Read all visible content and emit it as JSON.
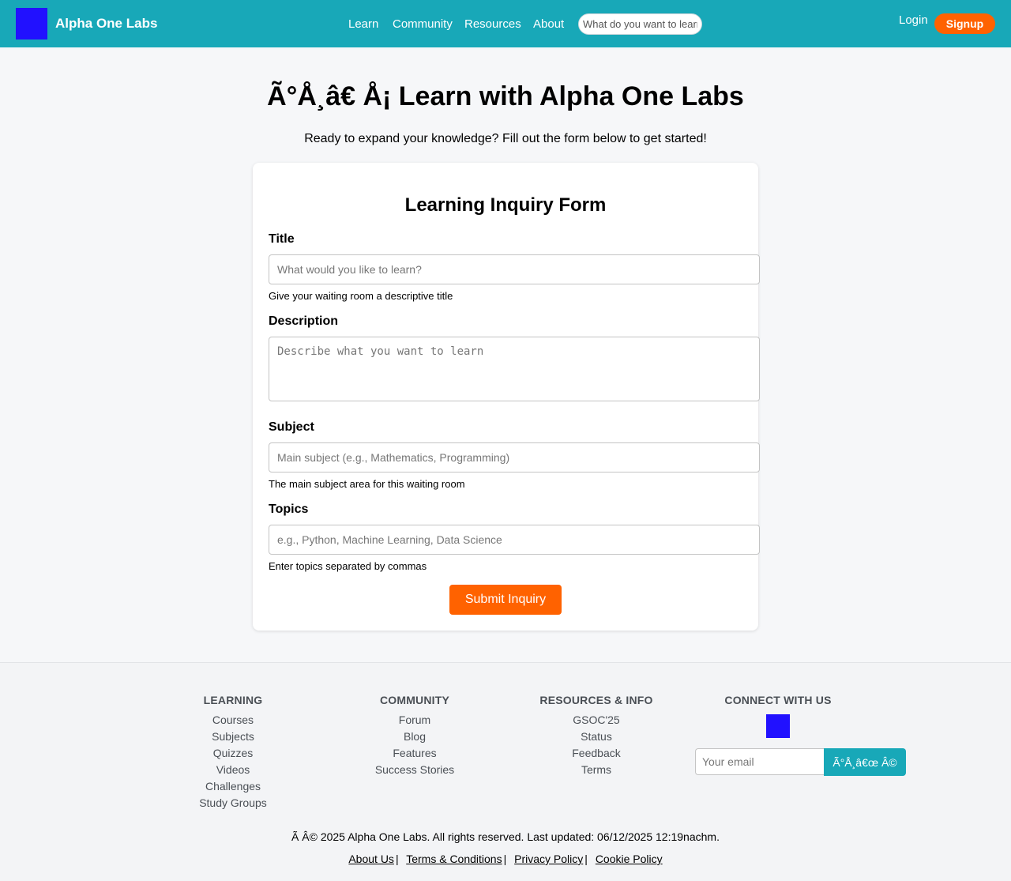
{
  "header": {
    "brand": "Alpha One Labs",
    "nav": [
      "Learn",
      "Community",
      "Resources",
      "About"
    ],
    "search_placeholder": "What do you want to learn?",
    "login": "Login",
    "signup": "Signup",
    "colors": {
      "bar": "#18a8b8",
      "logo": "#2111ff",
      "signup": "#ff6200"
    }
  },
  "hero": {
    "title": "Ã°Å¸â€   Å¡ Learn with Alpha One Labs",
    "subtitle": "Ready to expand your knowledge? Fill out the form below to get started!"
  },
  "form": {
    "title": "Learning Inquiry Form",
    "fields": {
      "title": {
        "label": "Title",
        "placeholder": "What would you like to learn?",
        "help": "Give your waiting room a descriptive title"
      },
      "description": {
        "label": "Description",
        "placeholder": "Describe what you want to learn"
      },
      "subject": {
        "label": "Subject",
        "placeholder": "Main subject (e.g., Mathematics, Programming)",
        "help": "The main subject area for this waiting room"
      },
      "topics": {
        "label": "Topics",
        "placeholder": "e.g., Python, Machine Learning, Data Science",
        "help": "Enter topics separated by commas"
      }
    },
    "submit": "Submit Inquiry"
  },
  "footer": {
    "learning": {
      "heading": "LEARNING",
      "links": [
        "Courses",
        "Subjects",
        "Quizzes",
        "Videos",
        "Challenges",
        "Study Groups"
      ]
    },
    "community": {
      "heading": "COMMUNITY",
      "links": [
        "Forum",
        "Blog",
        "Features",
        "Success Stories"
      ]
    },
    "resources": {
      "heading": "RESOURCES & INFO",
      "links": [
        "GSOC'25",
        "Status",
        "Feedback",
        "Terms"
      ]
    },
    "connect": {
      "heading": "CONNECT WITH US",
      "email_placeholder": "Your email",
      "subscribe": "Ã°Å¸â€œ Â©"
    },
    "copyright": "Ã   Â© 2025 Alpha One Labs. All rights reserved. Last updated: 06/12/2025 12:19nachm.",
    "legal": [
      "About Us",
      "Terms & Conditions",
      "Privacy Policy",
      "Cookie Policy"
    ]
  }
}
